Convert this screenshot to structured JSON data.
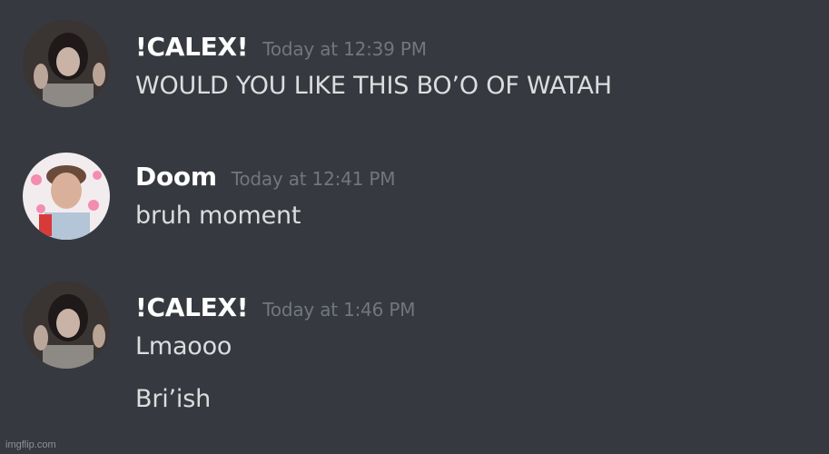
{
  "messages": [
    {
      "username": "!CALEX!",
      "timestamp": "Today at 12:39 PM",
      "lines": [
        "WOULD YOU LIKE THIS BO’O OF WATAH"
      ],
      "avatar_icon": "user-avatar-icon"
    },
    {
      "username": "Doom",
      "timestamp": "Today at 12:41 PM",
      "lines": [
        "bruh moment"
      ],
      "avatar_icon": "user-avatar-icon"
    },
    {
      "username": "!CALEX!",
      "timestamp": "Today at 1:46 PM",
      "lines": [
        "Lmaooo",
        "Bri’ish"
      ],
      "avatar_icon": "user-avatar-icon"
    }
  ],
  "watermark": "imgflip.com",
  "colors": {
    "background": "#36393f",
    "username": "#ffffff",
    "timestamp": "#72767d",
    "message_text": "#dcddde"
  }
}
